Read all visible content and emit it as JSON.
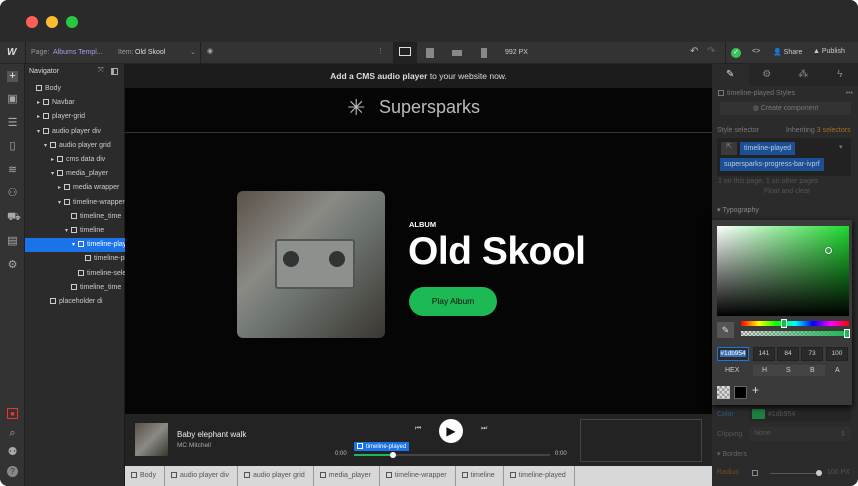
{
  "window": {
    "traffic": [
      "#fe5f57",
      "#febc2e",
      "#28c840"
    ]
  },
  "topbar": {
    "logo": "W",
    "page_label": "Page:",
    "page_value": "Albums Templ...",
    "item_label": "Item:",
    "item_value": "Old Skool",
    "width": "992 PX",
    "share": "Share",
    "publish": "Publish"
  },
  "navigator": {
    "title": "Navigator",
    "items": [
      {
        "label": "Body",
        "depth": 0,
        "caret": ""
      },
      {
        "label": "Navbar",
        "depth": 1,
        "caret": "▸"
      },
      {
        "label": "player-grid",
        "depth": 1,
        "caret": "▸"
      },
      {
        "label": "audio player div",
        "depth": 1,
        "caret": "▾"
      },
      {
        "label": "audio player grid",
        "depth": 2,
        "caret": "▾"
      },
      {
        "label": "cms data div",
        "depth": 3,
        "caret": "▸"
      },
      {
        "label": "media_player",
        "depth": 3,
        "caret": "▾"
      },
      {
        "label": "media wrapper",
        "depth": 4,
        "caret": "▸"
      },
      {
        "label": "timeline-wrapper",
        "depth": 4,
        "caret": "▾"
      },
      {
        "label": "timeline_time",
        "depth": 5,
        "caret": ""
      },
      {
        "label": "timeline",
        "depth": 5,
        "caret": "▾"
      },
      {
        "label": "timeline-played",
        "depth": 6,
        "caret": "▾",
        "selected": true
      },
      {
        "label": "timeline-played-bar",
        "depth": 7,
        "caret": ""
      },
      {
        "label": "timeline-selector",
        "depth": 6,
        "caret": ""
      },
      {
        "label": "timeline_time",
        "depth": 5,
        "caret": ""
      },
      {
        "label": "placeholder di",
        "depth": 2,
        "caret": ""
      }
    ]
  },
  "canvas": {
    "banner_bold": "Add a CMS audio player",
    "banner_rest": " to your website now.",
    "brand": "Supersparks",
    "eyebrow": "ALBUM",
    "album_title": "Old Skool",
    "play_button": "Play Album"
  },
  "player": {
    "track": "Baby elephant walk",
    "artist": "MC Mitchell",
    "time_start": "0:00",
    "time_end": "0:00",
    "selected_tag": "timeline-played",
    "progress": 0.2
  },
  "breadcrumbs": [
    "Body",
    "audio player div",
    "audio player grid",
    "media_player",
    "timeline-wrapper",
    "timeline",
    "timeline-played"
  ],
  "style_panel": {
    "element_styles": "timeline-played Styles",
    "create_component": "Create component",
    "selector_label": "Style selector",
    "inheriting": "Inheriting",
    "inheriting_count": "3 selectors",
    "class1": "timeline-played",
    "class2": "supersparks-progress-bar-ivprf",
    "usage": "1 on this page, 1 on other pages",
    "float": "Float and clear",
    "typography": "Typography",
    "color_label": "Color",
    "color_value": "#1db954",
    "clipping_label": "Clipping",
    "clipping_value": "None",
    "borders": "Borders",
    "radius_label": "Radius",
    "radius_value": "100",
    "radius_unit": "PX"
  },
  "picker": {
    "hex": "#1db954",
    "h": "141",
    "s": "84",
    "b": "73",
    "a": "100",
    "labels": [
      "HEX",
      "H",
      "S",
      "B",
      "A"
    ],
    "accent": "#1db954"
  }
}
